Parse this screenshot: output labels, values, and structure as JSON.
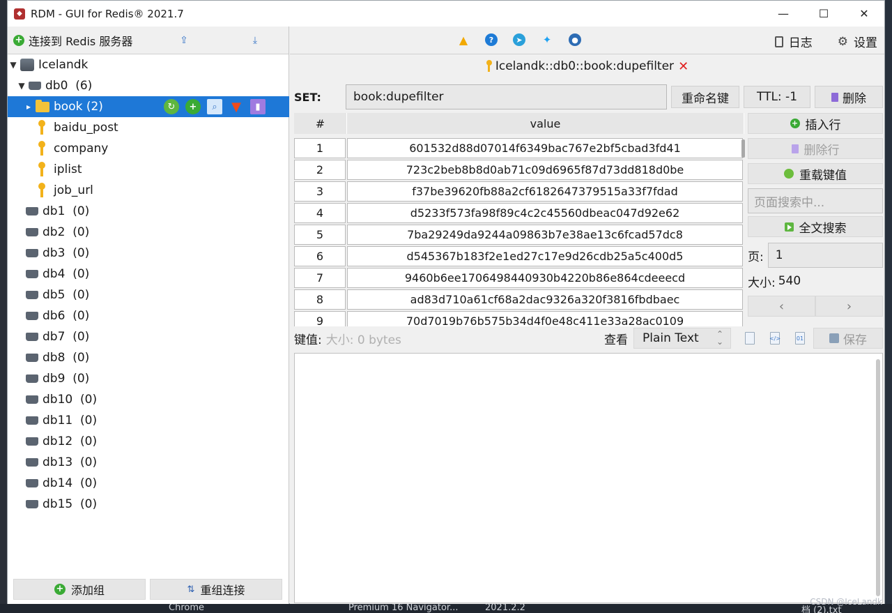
{
  "window": {
    "title": "RDM - GUI for Redis® 2021.7",
    "controls": {
      "minimize": "—",
      "maximize": "☐",
      "close": "✕"
    }
  },
  "left_toolbar": {
    "connect_label": "连接到 Redis 服务器",
    "icons": [
      "import-icon",
      "export-icon"
    ]
  },
  "tree": {
    "server": "Icelandk",
    "db0": {
      "name": "db0",
      "count": "(6)"
    },
    "folder": {
      "name": "book (2)"
    },
    "keys": [
      "baidu_post",
      "company",
      "iplist",
      "job_url"
    ],
    "databases": [
      {
        "name": "db1",
        "count": "(0)"
      },
      {
        "name": "db2",
        "count": "(0)"
      },
      {
        "name": "db3",
        "count": "(0)"
      },
      {
        "name": "db4",
        "count": "(0)"
      },
      {
        "name": "db5",
        "count": "(0)"
      },
      {
        "name": "db6",
        "count": "(0)"
      },
      {
        "name": "db7",
        "count": "(0)"
      },
      {
        "name": "db8",
        "count": "(0)"
      },
      {
        "name": "db9",
        "count": "(0)"
      },
      {
        "name": "db10",
        "count": "(0)"
      },
      {
        "name": "db11",
        "count": "(0)"
      },
      {
        "name": "db12",
        "count": "(0)"
      },
      {
        "name": "db13",
        "count": "(0)"
      },
      {
        "name": "db14",
        "count": "(0)"
      },
      {
        "name": "db15",
        "count": "(0)"
      }
    ]
  },
  "left_bottom": {
    "add_group": "添加组",
    "reorder": "重组连接"
  },
  "right_toolbar": {
    "log": "日志",
    "settings": "设置"
  },
  "tab": {
    "label": "Icelandk::db0::book:dupefilter",
    "close": "✕"
  },
  "key_header": {
    "type_label": "SET:",
    "key_name": "book:dupefilter",
    "rename": "重命名键",
    "ttl": "TTL:  -1",
    "delete": "删除"
  },
  "table": {
    "headers": [
      "#",
      "value"
    ],
    "rows": [
      [
        "1",
        "601532d88d07014f6349bac767e2bf5cbad3fd41"
      ],
      [
        "2",
        "723c2beb8b8d0ab71c09d6965f87d73dd818d0be"
      ],
      [
        "3",
        "f37be39620fb88a2cf6182647379515a33f7fdad"
      ],
      [
        "4",
        "d5233f573fa98f89c4c2c45560dbeac047d92e62"
      ],
      [
        "5",
        "7ba29249da9244a09863b7e38ae13c6fcad57dc8"
      ],
      [
        "6",
        "d545367b183f2e1ed27c17e9d26cdb25a5c400d5"
      ],
      [
        "7",
        "9460b6ee1706498440930b4220b86e864cdeeecd"
      ],
      [
        "8",
        "ad83d710a61cf68a2dac9326a320f3816fbdbaec"
      ],
      [
        "9",
        "70d7019b76b575b34d4f0e48c411e33a28ac0109"
      ]
    ]
  },
  "side_panel": {
    "insert_row": "插入行",
    "delete_row": "删除行",
    "reload": "重载键值",
    "search_placeholder": "页面搜索中...",
    "fulltext": "全文搜索",
    "page_label": "页:",
    "page_value": "1",
    "size_label": "大小:",
    "size_value": "540",
    "prev": "‹",
    "next": "›"
  },
  "value_bar": {
    "label": "键值:",
    "size": "大小: 0 bytes",
    "view_label": "查看",
    "view_mode": "Plain Text",
    "save": "保存"
  },
  "taskbar": {
    "items": [
      "Chrome",
      "Premium 16 Navigator...",
      "2021.2.2",
      "档 (2).txt"
    ],
    "watermark": "CSDN @IceLandk"
  }
}
